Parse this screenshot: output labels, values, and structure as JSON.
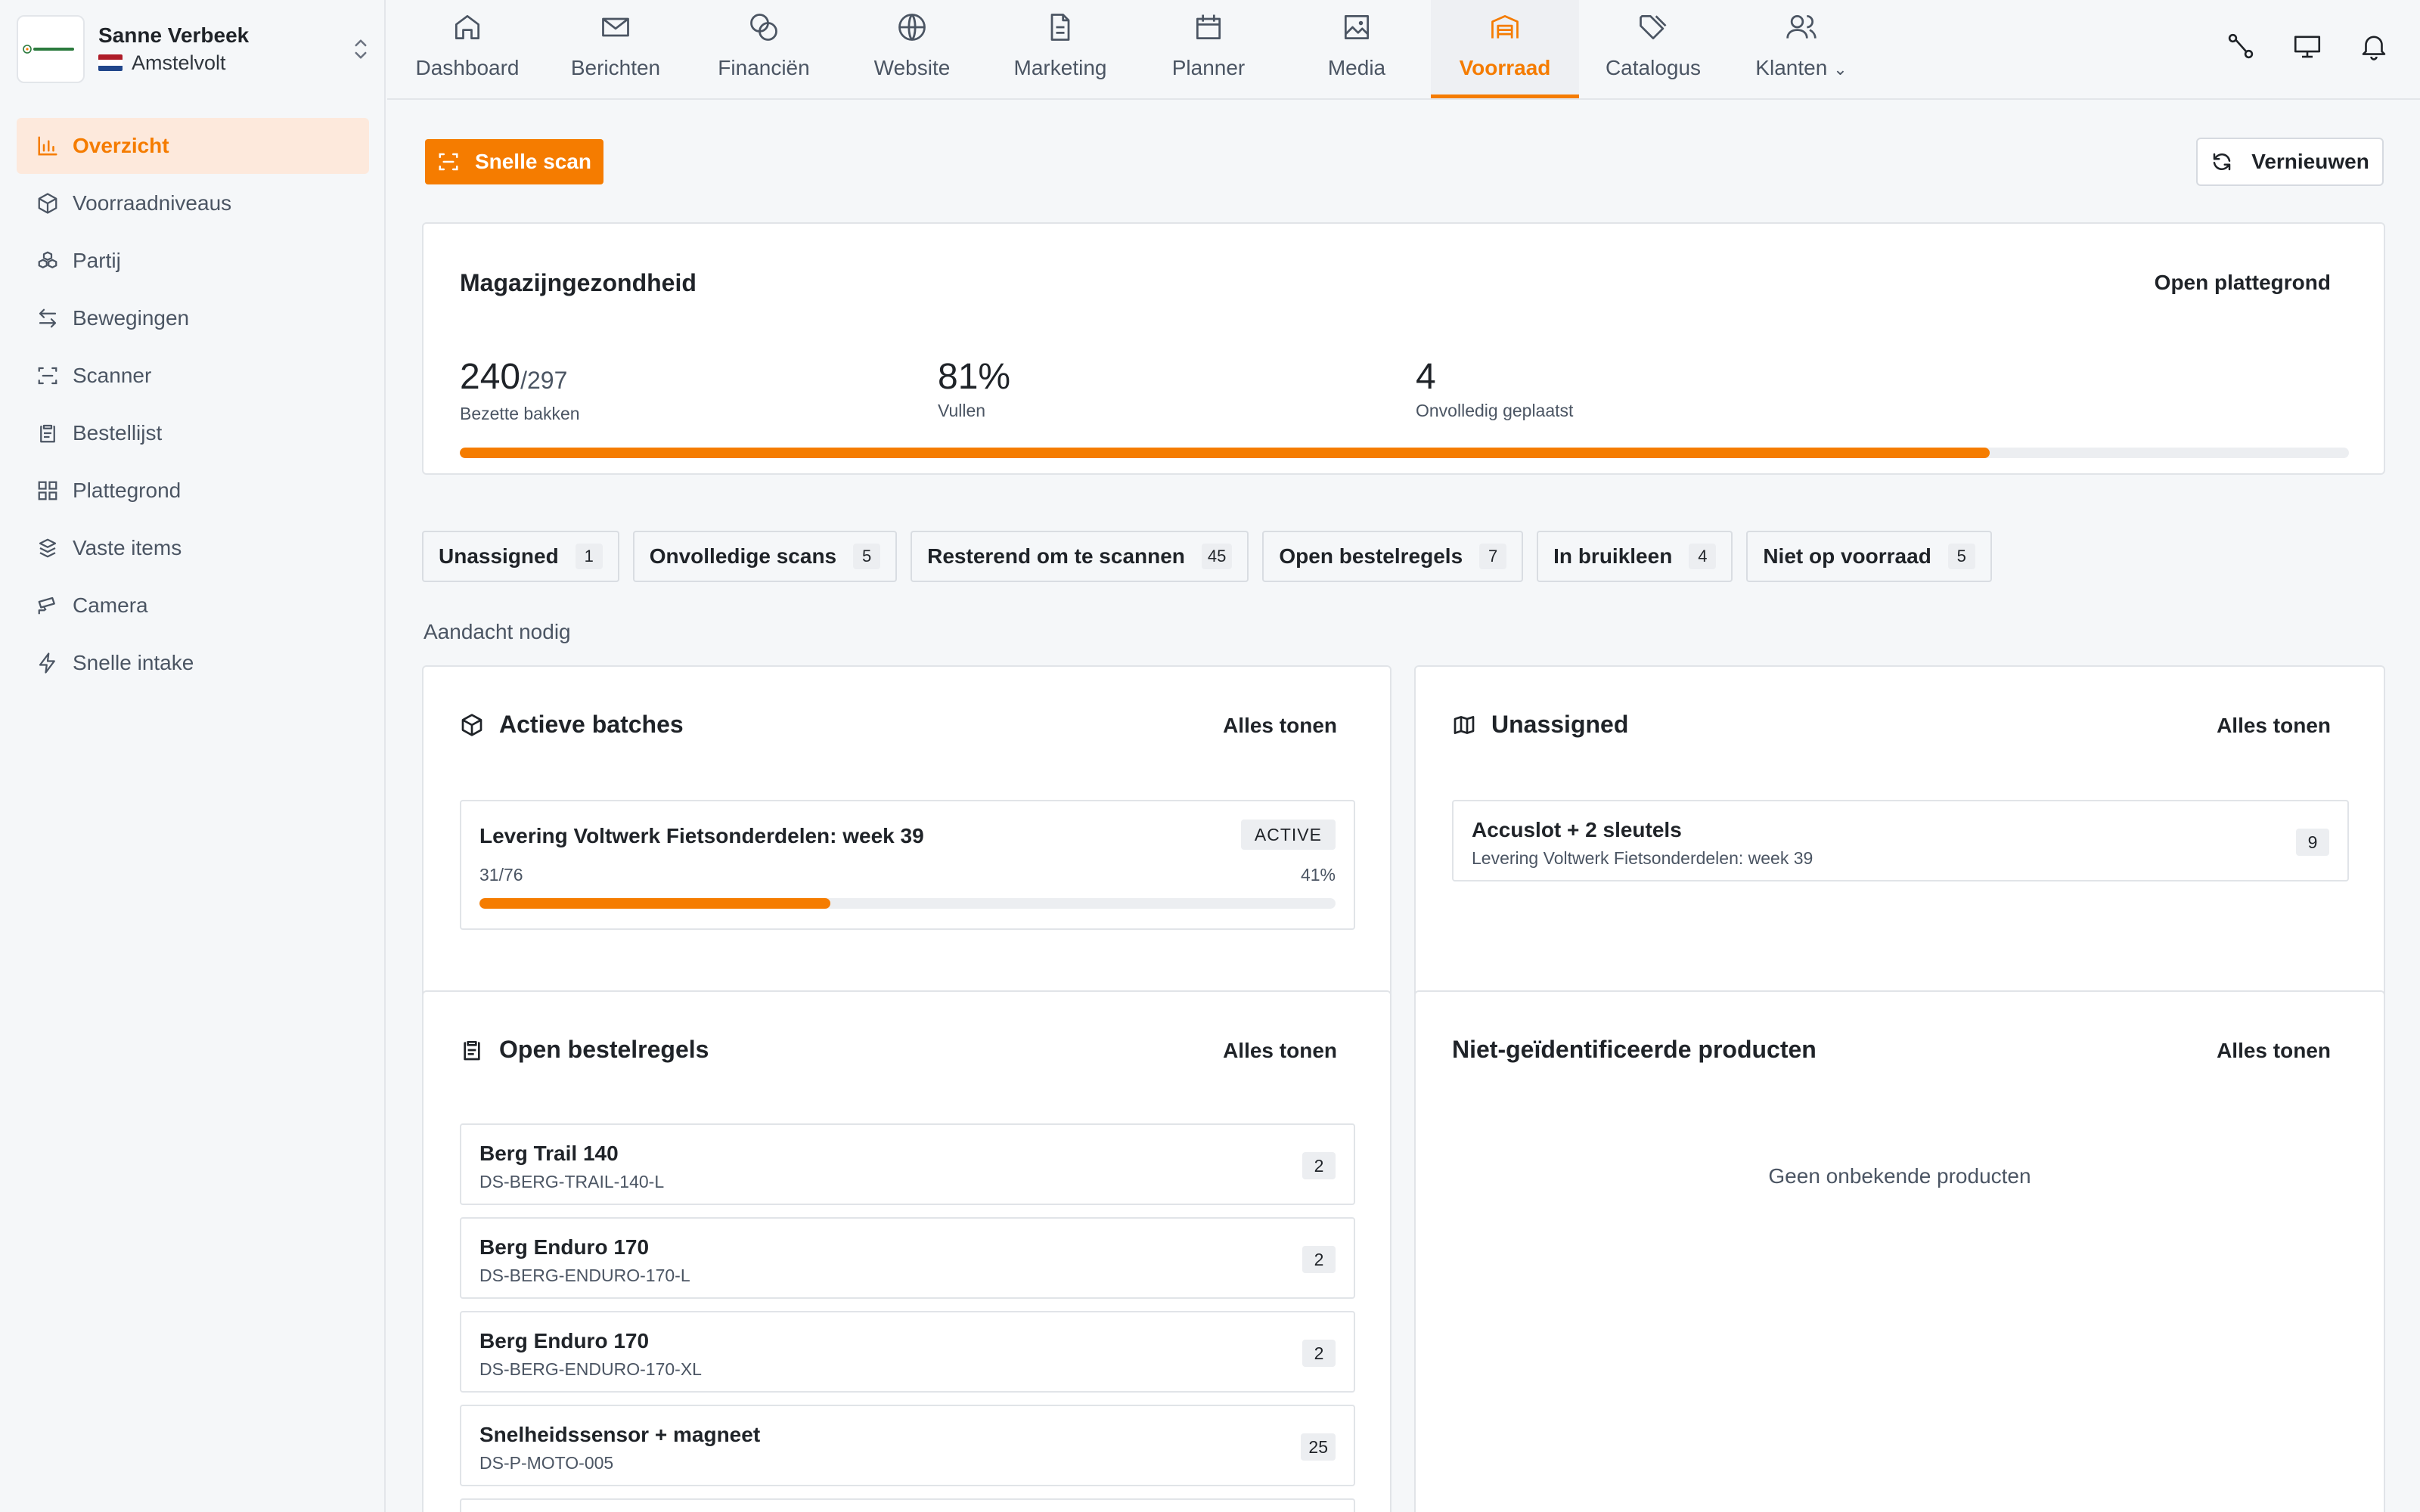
{
  "account": {
    "name": "Sanne Verbeek",
    "org": "Amstelvolt",
    "flag_colors": [
      "#ae1c28",
      "#ffffff",
      "#21468b"
    ]
  },
  "sidebar": {
    "items": [
      {
        "label": "Overzicht",
        "icon": "bar-chart-icon",
        "active": true
      },
      {
        "label": "Voorraadniveaus",
        "icon": "box-icon"
      },
      {
        "label": "Partij",
        "icon": "boxes-icon"
      },
      {
        "label": "Bewegingen",
        "icon": "arrows-left-right-icon"
      },
      {
        "label": "Scanner",
        "icon": "scan-icon"
      },
      {
        "label": "Bestellijst",
        "icon": "clipboard-icon"
      },
      {
        "label": "Plattegrond",
        "icon": "grid-icon"
      },
      {
        "label": "Vaste items",
        "icon": "squares-icon"
      },
      {
        "label": "Camera",
        "icon": "cctv-icon"
      },
      {
        "label": "Snelle intake",
        "icon": "zap-icon"
      }
    ]
  },
  "topnav": {
    "tabs": [
      {
        "label": "Dashboard",
        "icon": "home-icon"
      },
      {
        "label": "Berichten",
        "icon": "mail-icon"
      },
      {
        "label": "Financiën",
        "icon": "coins-icon"
      },
      {
        "label": "Website",
        "icon": "globe-icon"
      },
      {
        "label": "Marketing",
        "icon": "document-icon"
      },
      {
        "label": "Planner",
        "icon": "calendar-icon"
      },
      {
        "label": "Media",
        "icon": "image-icon"
      },
      {
        "label": "Voorraad",
        "icon": "warehouse-icon",
        "active": true
      },
      {
        "label": "Catalogus",
        "icon": "tags-icon"
      },
      {
        "label": "Klanten",
        "icon": "users-icon",
        "dropdown": true
      }
    ],
    "actions": [
      "workflow-icon",
      "monitor-icon",
      "bell-icon"
    ]
  },
  "toolbar": {
    "scan_label": "Snelle scan",
    "refresh_label": "Vernieuwen"
  },
  "health": {
    "title": "Magazijngezondheid",
    "link": "Open plattegrond",
    "stats": [
      {
        "value": "240",
        "suffix": "/297",
        "label": "Bezette bakken"
      },
      {
        "value": "81%",
        "label": "Vullen"
      },
      {
        "value": "4",
        "label": "Onvolledig geplaatst"
      }
    ],
    "fill_fraction": 0.81
  },
  "chips": [
    {
      "label": "Unassigned",
      "count": "1"
    },
    {
      "label": "Onvolledige scans",
      "count": "5"
    },
    {
      "label": "Resterend om te scannen",
      "count": "45"
    },
    {
      "label": "Open bestelregels",
      "count": "7"
    },
    {
      "label": "In bruikleen",
      "count": "4"
    },
    {
      "label": "Niet op voorraad",
      "count": "5"
    }
  ],
  "attention_label": "Aandacht nodig",
  "batches": {
    "title": "Actieve batches",
    "link": "Alles tonen",
    "item": {
      "title": "Levering Voltwerk Fietsonderdelen: week 39",
      "status": "ACTIVE",
      "progress_text": "31/76",
      "percent_text": "41%",
      "fraction": 0.41
    }
  },
  "unassigned": {
    "title": "Unassigned",
    "link": "Alles tonen",
    "item": {
      "title": "Accuslot + 2 sleutels",
      "sub": "Levering Voltwerk Fietsonderdelen: week 39",
      "count": "9"
    }
  },
  "orderlines": {
    "title": "Open bestelregels",
    "link": "Alles tonen",
    "items": [
      {
        "title": "Berg Trail 140",
        "sku": "DS-BERG-TRAIL-140-L",
        "count": "2"
      },
      {
        "title": "Berg Enduro 170",
        "sku": "DS-BERG-ENDURO-170-L",
        "count": "2"
      },
      {
        "title": "Berg Enduro 170",
        "sku": "DS-BERG-ENDURO-170-XL",
        "count": "2"
      },
      {
        "title": "Snelheidssensor + magneet",
        "sku": "DS-P-MOTO-005",
        "count": "25"
      }
    ]
  },
  "unidentified": {
    "title": "Niet-geïdentificeerde producten",
    "link": "Alles tonen",
    "empty": "Geen onbekende producten"
  },
  "colors": {
    "accent": "#f57c00",
    "accent_light": "#fde9dc"
  }
}
